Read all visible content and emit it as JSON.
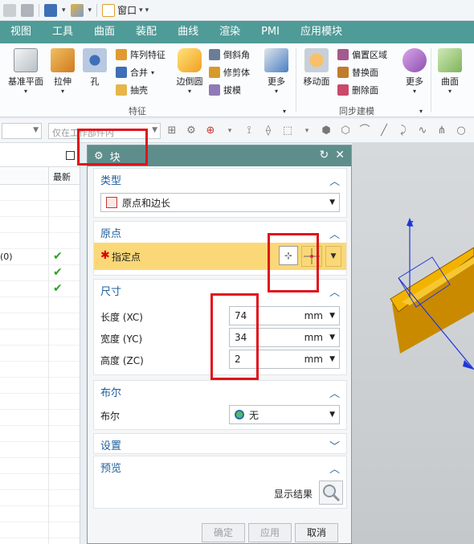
{
  "quick_access": {
    "window_label": "窗口"
  },
  "ribbon_tabs": [
    "视图",
    "工具",
    "曲面",
    "装配",
    "曲线",
    "渲染",
    "PMI",
    "应用模块"
  ],
  "ribbon": {
    "datum_plane": "基准平面",
    "extrude": "拉伸",
    "hole": "孔",
    "pattern_feature": "阵列特征",
    "unite": "合并",
    "shell": "抽壳",
    "edge_blend": "边倒圆",
    "chamfer": "倒斜角",
    "trim_body": "修剪体",
    "draft": "拔模",
    "more1": "更多",
    "move_face": "移动面",
    "offset_region": "偏置区域",
    "replace_face": "替换面",
    "delete_face": "删除面",
    "more2": "更多",
    "surface": "曲面",
    "group_feature": "特征",
    "group_sync": "同步建模"
  },
  "selbar": {
    "filter_placeholder": "仅在工作部件内"
  },
  "navigator": {
    "col_latest": "最新",
    "rows": [
      {
        "text": "",
        "check": ""
      },
      {
        "text": "",
        "check": ""
      },
      {
        "text": "",
        "check": ""
      },
      {
        "text": "",
        "check": ""
      },
      {
        "text": "(0)",
        "check": "✔"
      },
      {
        "text": "",
        "check": "✔"
      },
      {
        "text": "",
        "check": "✔"
      },
      {
        "text": "",
        "check": ""
      },
      {
        "text": "",
        "check": ""
      },
      {
        "text": "",
        "check": ""
      },
      {
        "text": "",
        "check": ""
      },
      {
        "text": "",
        "check": ""
      },
      {
        "text": "",
        "check": ""
      },
      {
        "text": "",
        "check": ""
      },
      {
        "text": "",
        "check": ""
      },
      {
        "text": "",
        "check": ""
      },
      {
        "text": "",
        "check": ""
      },
      {
        "text": "",
        "check": ""
      },
      {
        "text": "",
        "check": ""
      },
      {
        "text": "",
        "check": ""
      },
      {
        "text": "",
        "check": ""
      },
      {
        "text": "",
        "check": ""
      },
      {
        "text": "",
        "check": ""
      }
    ]
  },
  "dialog": {
    "title": "块",
    "type": {
      "header": "类型",
      "value": "原点和边长"
    },
    "origin": {
      "header": "原点",
      "specify_point": "指定点"
    },
    "dimensions": {
      "header": "尺寸",
      "length_label": "长度 (XC)",
      "length_value": "74",
      "length_unit": "mm",
      "width_label": "宽度 (YC)",
      "width_value": "34",
      "width_unit": "mm",
      "height_label": "高度 (ZC)",
      "height_value": "2",
      "height_unit": "mm"
    },
    "boolean": {
      "header": "布尔",
      "label": "布尔",
      "value": "无"
    },
    "settings": {
      "header": "设置"
    },
    "preview": {
      "header": "预览",
      "show_result": "显示结果"
    },
    "buttons": {
      "ok": "确定",
      "apply": "应用",
      "cancel": "取消"
    }
  },
  "viewport": {
    "z_axis": "Z"
  },
  "colors": {
    "tab_bg": "#4f9b97",
    "dialog_title_bg": "#5e8e8c",
    "highlight": "#e0141b",
    "block_fill": "#f2b300",
    "section_header": "#1e5f9c"
  }
}
